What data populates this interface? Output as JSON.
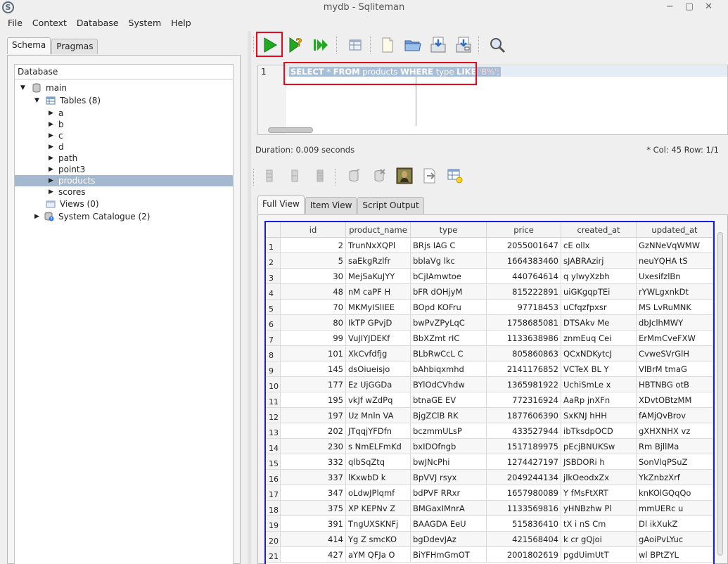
{
  "window": {
    "title": "mydb - Sqliteman",
    "controls": [
      "−",
      "▢",
      "✕"
    ]
  },
  "menu": [
    "File",
    "Context",
    "Database",
    "System",
    "Help"
  ],
  "left_tabs": [
    "Schema",
    "Pragmas"
  ],
  "tree": {
    "header": "Database",
    "main": "main",
    "tables": "Tables (8)",
    "table_items": [
      "a",
      "b",
      "c",
      "d",
      "path",
      "point3",
      "products",
      "scores"
    ],
    "selected": "products",
    "views": "Views (0)",
    "system": "System Catalogue (2)"
  },
  "editor": {
    "line_number": "1",
    "sql_parts": [
      "SELECT",
      " * ",
      "FROM",
      " products ",
      "WHERE",
      " type ",
      "LIKE",
      " 'B%';"
    ]
  },
  "status": {
    "duration": "Duration: 0.009 seconds",
    "position": "*   Col: 45 Row: 1/1"
  },
  "result_tabs": [
    "Full View",
    "Item View",
    "Script Output"
  ],
  "columns": [
    "id",
    "product_name",
    "type",
    "price",
    "created_at",
    "updated_at"
  ],
  "rows": [
    [
      "2",
      "TrunNxXQPl",
      "BRjs IAG C",
      "2055001647",
      "cE ollx",
      "GzNNeVqWMW"
    ],
    [
      "5",
      "saEkgRzlfr",
      "bblaVg lkc",
      "1664383460",
      "sJABRAzirj",
      "neuYQHA tS"
    ],
    [
      "30",
      "MejSaKuJYY",
      "bCjIAmwtoe",
      "440764614",
      "q ylwyXzbh",
      "UxesifzlBn"
    ],
    [
      "48",
      "nM caPF H",
      "bFR dOHjyM",
      "815222891",
      "uiGKgqpTEi",
      "rYWLgxnkDt"
    ],
    [
      "70",
      "MKMyISlIEE",
      "BOpd KOFru",
      "97718453",
      "uCfqzfpxsr",
      "MS LvRuMNK"
    ],
    [
      "80",
      "IkTP GPvjD",
      "bwPvZPyLqC",
      "1758685081",
      "DTSAkv Me",
      "dbJclhMWY"
    ],
    [
      "99",
      "VuJIYJDEKf",
      "BbXZmt rIC",
      "1133638986",
      "znmEuq Cei",
      "ErMmCveFXW"
    ],
    [
      "101",
      "XkCvfdfjg",
      "BLbRwCcL C",
      "805860863",
      "QCxNDKytcJ",
      "CvweSVrGlH"
    ],
    [
      "145",
      "dsOiueisjo",
      "bAhbiqxmhd",
      "2141176852",
      "VCTeX BL Y",
      "VlBrM tmaG"
    ],
    [
      "177",
      "Ez UjGGDa",
      "BYlOdCVhdw",
      "1365981922",
      "UchiSmLe x",
      "HBTNBG otB"
    ],
    [
      "195",
      "vkJf wZdPq",
      "btnaGE EV",
      "772316924",
      "AaRp jnXFn",
      "XDvtOBtzMM"
    ],
    [
      "197",
      "Uz Mnln VA",
      "BjgZClB RK",
      "1877606390",
      "SxKNJ hHH",
      "fAMjQvBrov"
    ],
    [
      "202",
      "JTqqjYFDfn",
      "bczmmULsP",
      "433527944",
      "ibTksdpOCD",
      "gXHXNHX vz"
    ],
    [
      "230",
      "s NmELFmKd",
      "bxIDOfngb",
      "1517189975",
      "pEcjBNUKSw",
      "Rm BjllMa"
    ],
    [
      "332",
      "qlbSqZtq",
      "bwJNcPhi",
      "1274427197",
      "JSBDORi h",
      "SonVlqPSuZ"
    ],
    [
      "337",
      "lKxwbD k",
      "BpVVJ rsyx",
      "2049244134",
      "jlkOeodxZx",
      "YkZnbzXrf"
    ],
    [
      "347",
      "oLdwJPlqmf",
      "bdPVF RRxr",
      "1657980089",
      "Y fMsFtXRT",
      "knKOlGQqQo"
    ],
    [
      "375",
      "XP KEPNv Z",
      "BMGaxIMnrA",
      "1133569816",
      "yHNBzhw Pl",
      "mmUERc u"
    ],
    [
      "391",
      "TngUXSKNFj",
      "BAAGDA EeU",
      "515836410",
      "tX i nS Cm",
      "Dl ikXukZ"
    ],
    [
      "414",
      "Yg Z smcKO",
      "bgDdevJAz",
      "421568404",
      "k cr gQjoi",
      "gAoiPvLYuc"
    ],
    [
      "427",
      "aYM QFJa O",
      "BiYFHmGmOT",
      "2001802619",
      "pgdUimUtT",
      "wl BPtZYL"
    ]
  ],
  "colors": {
    "selection": "#a4b8d0",
    "red_highlight": "#e00b1c",
    "blue_highlight": "#1a1ae6",
    "run_green": "#22a822"
  }
}
